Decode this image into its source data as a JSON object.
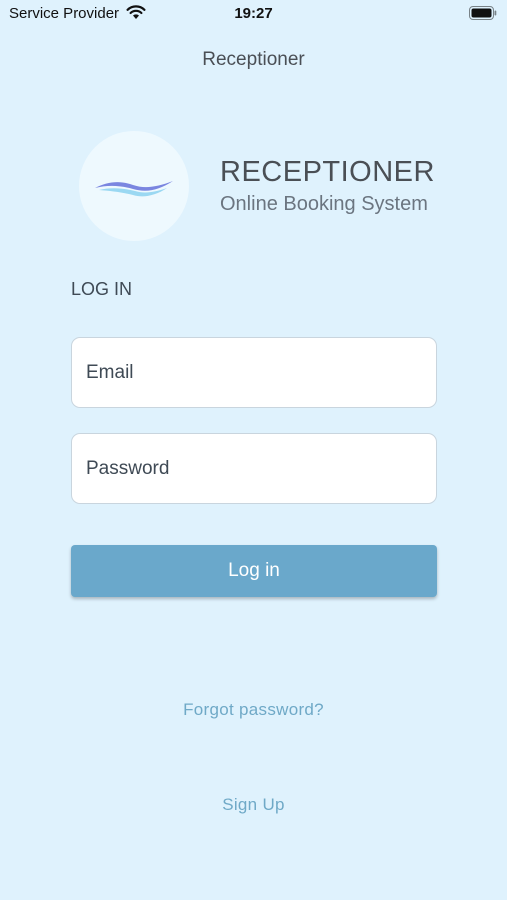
{
  "status_bar": {
    "carrier": "Service Provider",
    "time": "19:27",
    "wifi_icon": "wifi-icon",
    "battery_icon": "battery-icon"
  },
  "nav": {
    "title": "Receptioner"
  },
  "brand": {
    "name": "RECEPTIONER",
    "tagline": "Online Booking System",
    "logo_icon": "waves-logo-icon"
  },
  "login": {
    "heading": "LOG IN",
    "email_placeholder": "Email",
    "password_placeholder": "Password",
    "submit_label": "Log in",
    "forgot_label": "Forgot password?",
    "signup_label": "Sign Up"
  },
  "colors": {
    "background": "#dff2fd",
    "button": "#6aa8cb",
    "link": "#6fa9c7"
  }
}
